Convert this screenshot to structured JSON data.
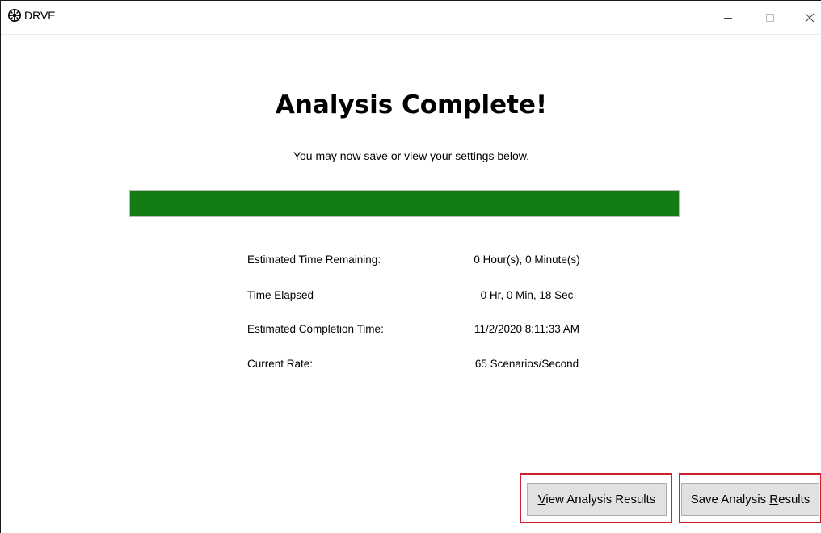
{
  "window": {
    "title": "DRVE",
    "icons": {
      "app": "drve-app-icon",
      "minimize": "minimize-icon",
      "maximize": "maximize-icon",
      "close": "close-icon"
    }
  },
  "main": {
    "heading": "Analysis Complete!",
    "subheading": "You may now save or view your settings below.",
    "progress": {
      "percent": 100,
      "color": "#137c14"
    },
    "stats": [
      {
        "label": "Estimated Time Remaining:",
        "value": "0 Hour(s), 0 Minute(s)"
      },
      {
        "label": "Time Elapsed",
        "value": "0 Hr, 0 Min, 18 Sec"
      },
      {
        "label": "Estimated Completion Time:",
        "value": "11/2/2020 8:11:33 AM"
      },
      {
        "label": "Current Rate:",
        "value": "65 Scenarios/Second"
      }
    ]
  },
  "actions": {
    "view_button": {
      "before": "",
      "accel": "V",
      "after": "iew Analysis Results"
    },
    "save_button": {
      "before": "Save Analysis ",
      "accel": "R",
      "after": "esults"
    },
    "highlight_color": "#d0202e"
  }
}
